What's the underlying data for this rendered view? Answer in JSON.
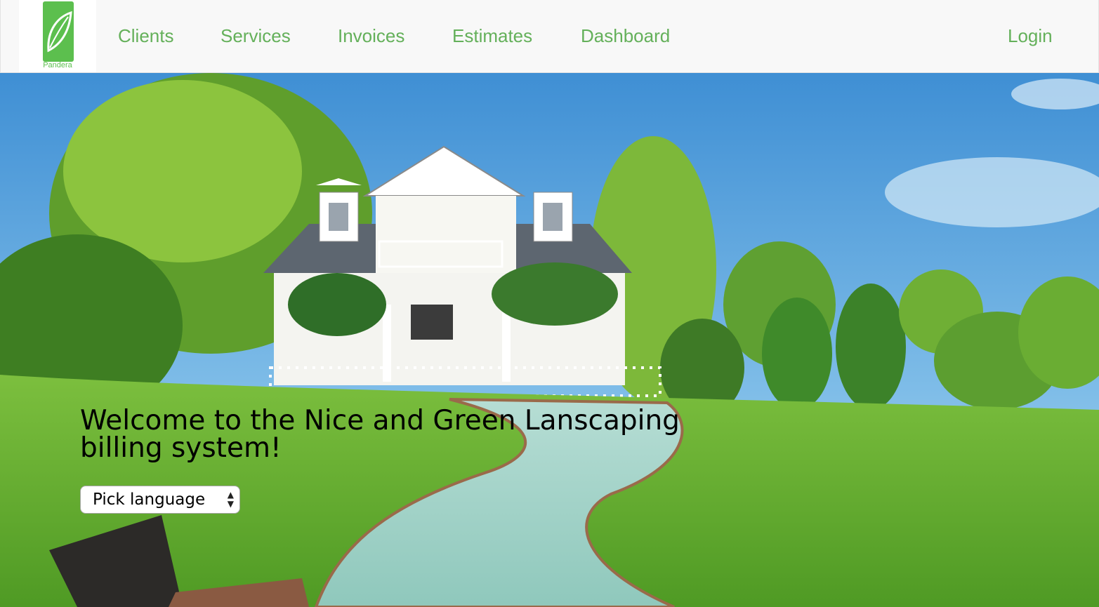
{
  "brand": {
    "logo_text": "Pandera",
    "color": "#5cbf4e"
  },
  "nav": {
    "links": [
      "Clients",
      "Services",
      "Invoices",
      "Estimates",
      "Dashboard"
    ],
    "login": "Login",
    "link_color": "#64b05a"
  },
  "hero": {
    "image": "landscaped-house-lawn-photo",
    "heading": "Welcome to the Nice and Green Lanscaping billing system!"
  },
  "language_select": {
    "value": "Pick language"
  }
}
